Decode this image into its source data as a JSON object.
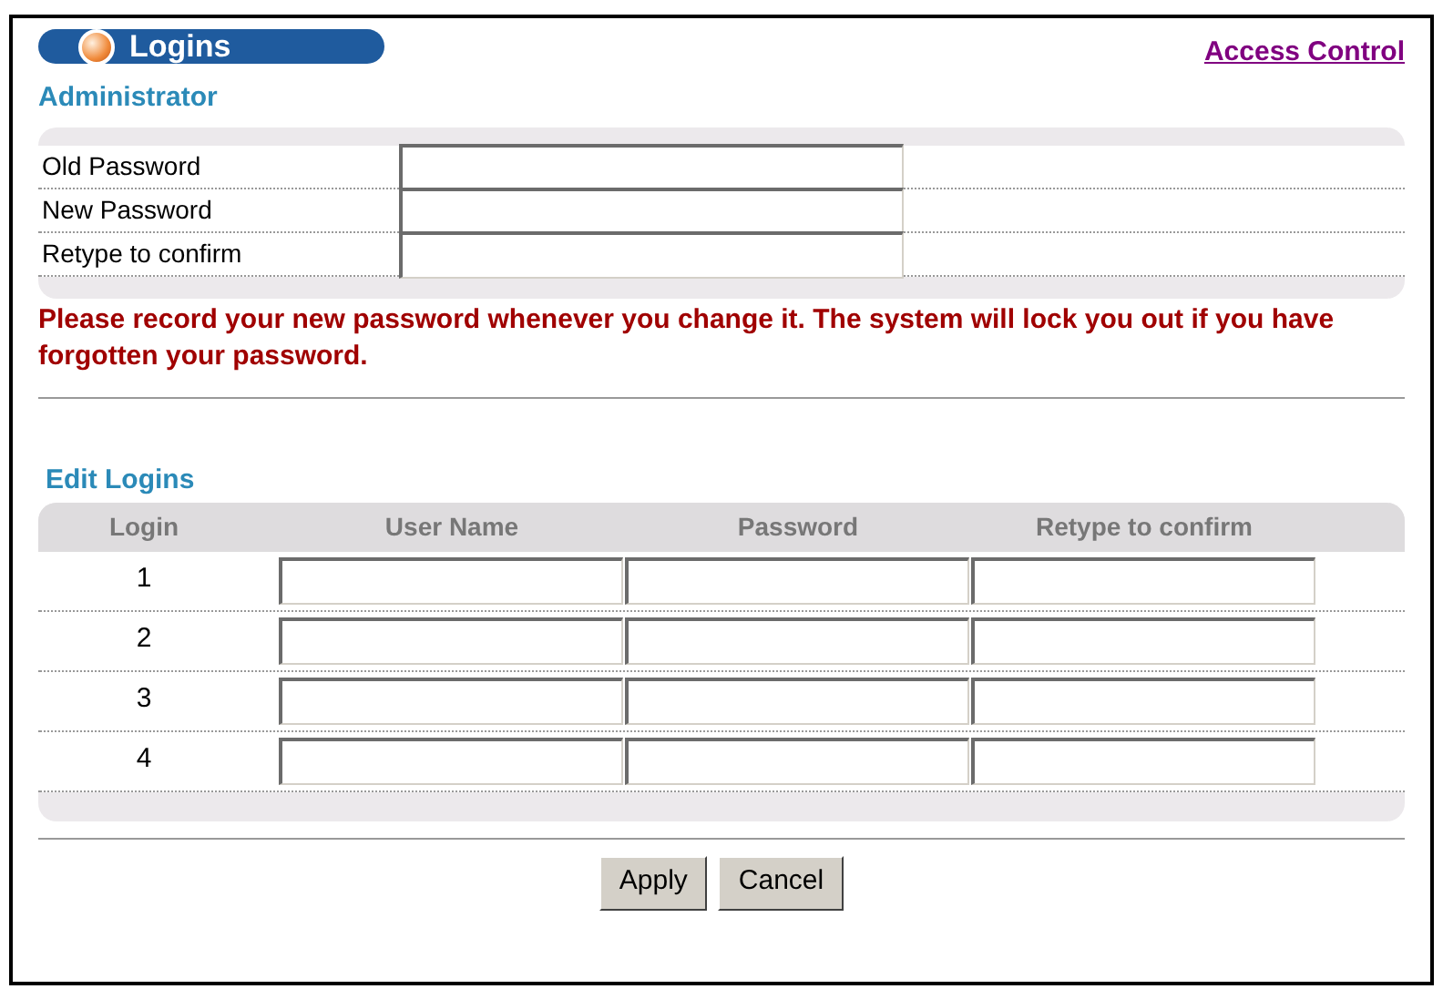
{
  "title": "Logins",
  "link": "Access Control",
  "administrator": {
    "heading": "Administrator",
    "fields": [
      {
        "label": "Old Password"
      },
      {
        "label": "New Password"
      },
      {
        "label": "Retype to confirm"
      }
    ]
  },
  "warning": "Please record your new password whenever you change it. The system will lock you out if you have forgotten your password.",
  "edit_logins": {
    "heading": "Edit Logins",
    "columns": [
      "Login",
      "User Name",
      "Password",
      "Retype to confirm"
    ],
    "rows": [
      {
        "login": "1"
      },
      {
        "login": "2"
      },
      {
        "login": "3"
      },
      {
        "login": "4"
      }
    ]
  },
  "buttons": [
    "Apply",
    "Cancel"
  ]
}
